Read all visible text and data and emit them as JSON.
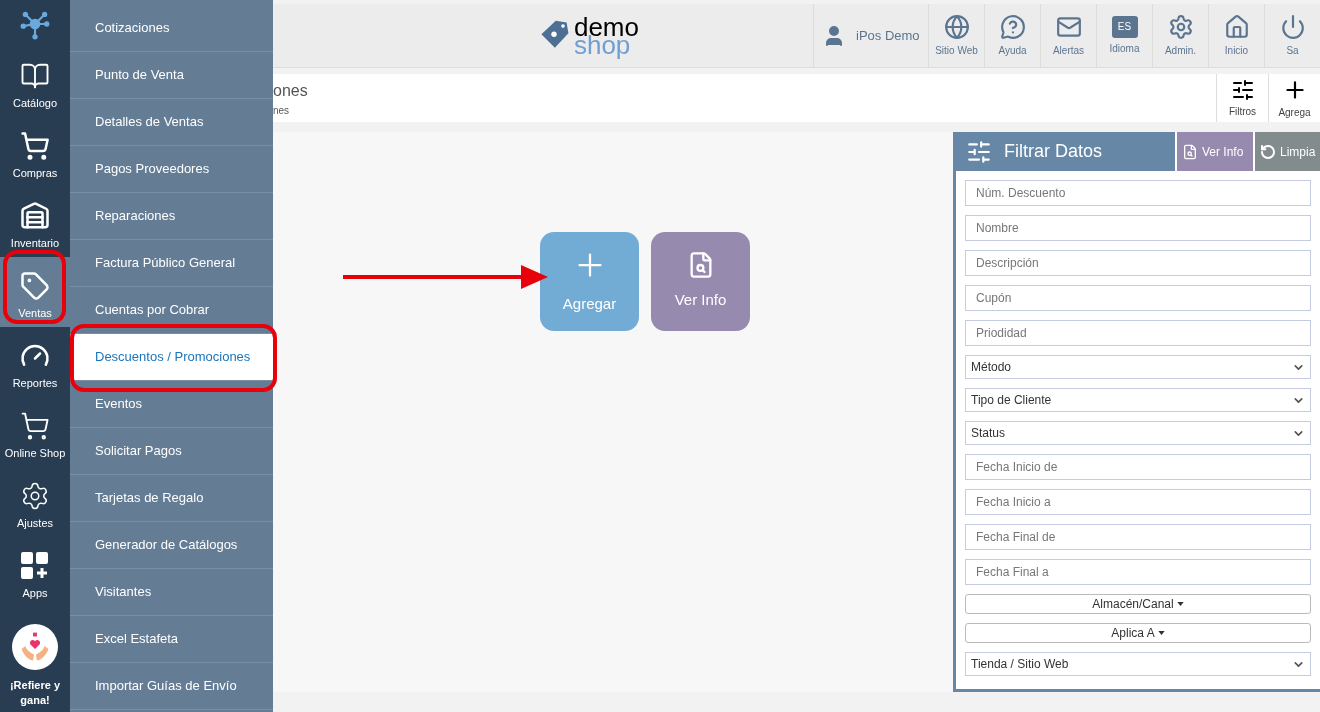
{
  "rail": {
    "items": [
      {
        "label": "Catálogo",
        "selected": false
      },
      {
        "label": "Compras",
        "selected": false
      },
      {
        "label": "Inventario",
        "selected": false
      },
      {
        "label": "Ventas",
        "selected": true
      },
      {
        "label": "Reportes",
        "selected": false
      },
      {
        "label": "Online Shop",
        "selected": false
      },
      {
        "label": "Ajustes",
        "selected": false
      },
      {
        "label": "Apps",
        "selected": false
      }
    ],
    "promo": "¡Refiere y gana!"
  },
  "submenu": [
    {
      "label": "Cotizaciones",
      "selected": false
    },
    {
      "label": "Punto de Venta",
      "selected": false
    },
    {
      "label": "Detalles de Ventas",
      "selected": false
    },
    {
      "label": "Pagos Proveedores",
      "selected": false
    },
    {
      "label": "Reparaciones",
      "selected": false
    },
    {
      "label": "Factura Público General",
      "selected": false
    },
    {
      "label": "Cuentas por Cobrar",
      "selected": false
    },
    {
      "label": "Descuentos / Promociones",
      "selected": true
    },
    {
      "label": "Eventos",
      "selected": false
    },
    {
      "label": "Solicitar Pagos",
      "selected": false
    },
    {
      "label": "Tarjetas de Regalo",
      "selected": false
    },
    {
      "label": "Generador de Catálogos",
      "selected": false
    },
    {
      "label": "Visitantes",
      "selected": false
    },
    {
      "label": "Excel Estafeta",
      "selected": false
    },
    {
      "label": "Importar Guías de Envío",
      "selected": false
    }
  ],
  "header": {
    "logo": {
      "top": "demo",
      "bottom": "shop"
    },
    "user": "iPos Demo",
    "nav": [
      {
        "label": "Sitio Web",
        "kind": "web"
      },
      {
        "label": "Ayuda",
        "kind": "help"
      },
      {
        "label": "Alertas",
        "kind": "mail"
      },
      {
        "label": "Idioma",
        "kind": "lang",
        "badge": "ES"
      },
      {
        "label": "Admin.",
        "kind": "gear"
      },
      {
        "label": "Inicio",
        "kind": "home"
      },
      {
        "label": "Sa",
        "kind": "power"
      }
    ]
  },
  "page": {
    "title": "ones",
    "subtitle": "nes",
    "actions": [
      {
        "label": "Filtros",
        "kind": "filter"
      },
      {
        "label": "Agrega",
        "kind": "add"
      }
    ]
  },
  "tiles": [
    {
      "label": "Agregar",
      "kind": "add"
    },
    {
      "label": "Ver Info",
      "kind": "info"
    }
  ],
  "filter": {
    "title": "Filtrar Datos",
    "buttons": [
      {
        "label": "Ver Info",
        "kind": "info"
      },
      {
        "label": "Limpia",
        "kind": "clear"
      }
    ],
    "fields": [
      {
        "kind": "input",
        "placeholder": "Núm. Descuento"
      },
      {
        "kind": "input",
        "placeholder": "Nombre"
      },
      {
        "kind": "input",
        "placeholder": "Descripción"
      },
      {
        "kind": "input",
        "placeholder": "Cupón"
      },
      {
        "kind": "input",
        "placeholder": "Priodidad"
      },
      {
        "kind": "select",
        "value": "Método"
      },
      {
        "kind": "select",
        "value": "Tipo de Cliente"
      },
      {
        "kind": "select",
        "value": "Status"
      },
      {
        "kind": "input",
        "placeholder": "Fecha Inicio de"
      },
      {
        "kind": "input",
        "placeholder": "Fecha Inicio a"
      },
      {
        "kind": "input",
        "placeholder": "Fecha Final de"
      },
      {
        "kind": "input",
        "placeholder": "Fecha Final a"
      },
      {
        "kind": "dropdown",
        "label": "Almacén/Canal"
      },
      {
        "kind": "dropdown",
        "label": "Aplica A"
      },
      {
        "kind": "select",
        "value": "Tienda / Sitio Web"
      }
    ]
  }
}
